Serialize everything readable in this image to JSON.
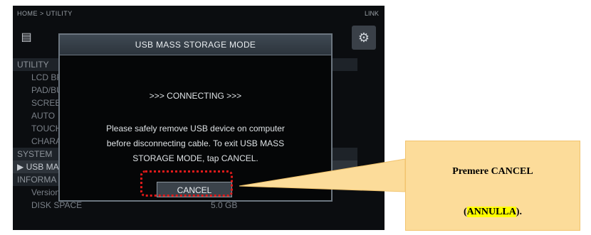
{
  "screen": {
    "breadcrumb": "HOME > UTILITY",
    "link_label": "LINK",
    "menu": [
      {
        "type": "section",
        "label": "UTILITY"
      },
      {
        "type": "item",
        "label": "LCD BR"
      },
      {
        "type": "item",
        "label": "PAD/BU"
      },
      {
        "type": "item",
        "label": "SCREEN"
      },
      {
        "type": "item",
        "label": "AUTO"
      },
      {
        "type": "item",
        "label": "TOUCH"
      },
      {
        "type": "item",
        "label": "CHARA"
      },
      {
        "type": "section",
        "label": "SYSTEM"
      },
      {
        "type": "selected",
        "label": "▶ USB MA"
      },
      {
        "type": "section",
        "label": "INFORMA"
      },
      {
        "type": "item",
        "label": "Version"
      },
      {
        "type": "item",
        "label": "DISK SPACE",
        "value": "5.0 GB"
      }
    ]
  },
  "dialog": {
    "title": "USB MASS STORAGE MODE",
    "status": ">>> CONNECTING >>>",
    "message_lines": [
      "Please safely remove USB device on computer",
      "before disconnecting cable. To exit USB MASS",
      "STORAGE MODE, tap CANCEL."
    ],
    "cancel_label": "CANCEL"
  },
  "callout": {
    "line1": "Premere CANCEL",
    "line2_open": "(",
    "line2_highlight": "ANNULLA",
    "line2_close": ")."
  },
  "colors": {
    "callout_fill": "#fcdc9a",
    "highlight_border": "#e11a1a",
    "text_highlight": "#ffff00"
  }
}
